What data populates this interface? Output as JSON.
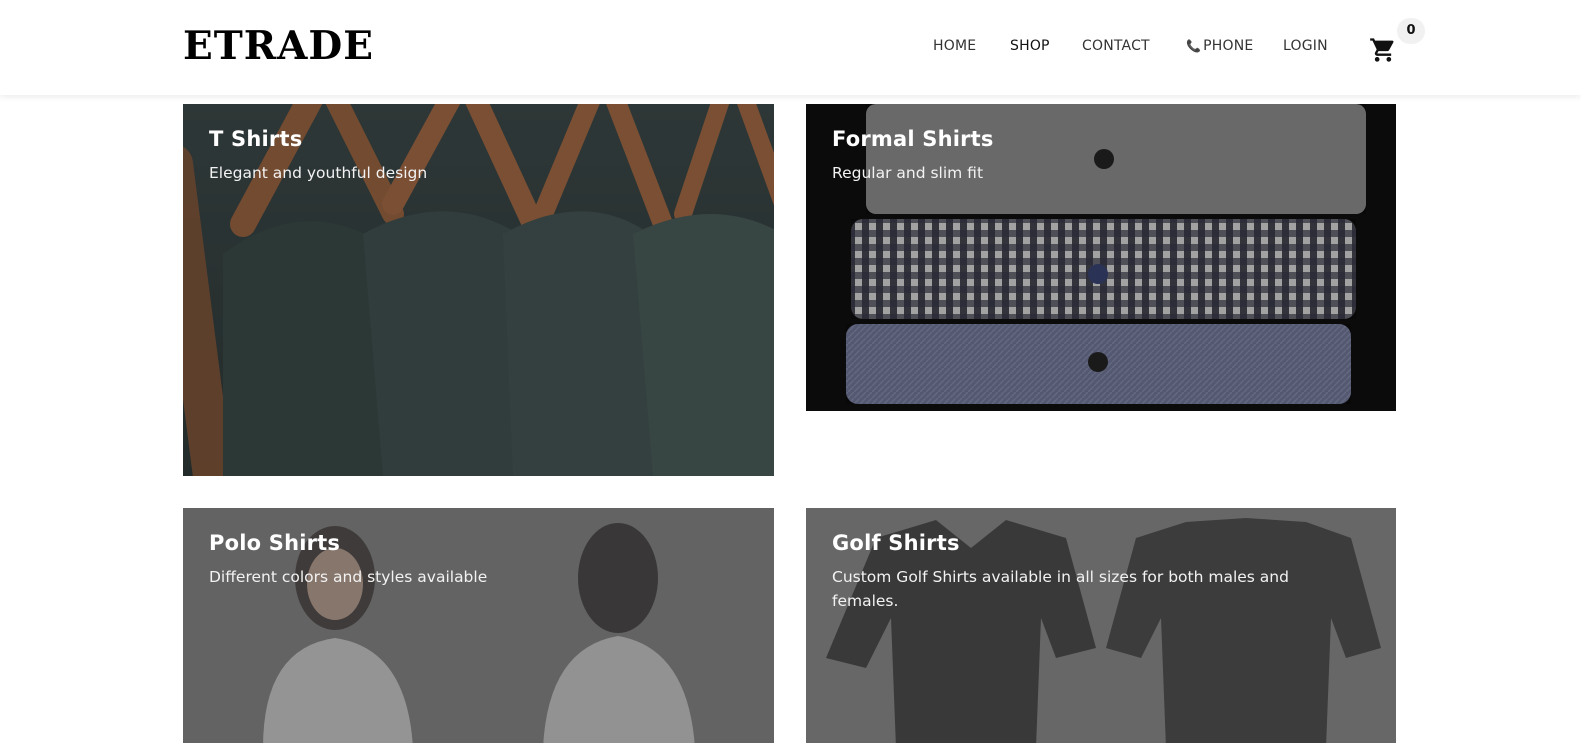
{
  "brand": {
    "logo_text": "ETRADE"
  },
  "nav": {
    "items": [
      {
        "label": "HOME"
      },
      {
        "label": "SHOP"
      },
      {
        "label": "CONTACT"
      },
      {
        "label": "PHONE",
        "icon": "phone-icon"
      },
      {
        "label": "LOGIN"
      }
    ],
    "cart": {
      "icon": "cart-icon",
      "count": "0"
    }
  },
  "tiles": [
    {
      "title": "T Shirts",
      "subtitle": "Elegant and youthful design"
    },
    {
      "title": "Formal Shirts",
      "subtitle": "Regular and slim fit"
    },
    {
      "title": "Polo Shirts",
      "subtitle": "Different colors and styles available"
    },
    {
      "title": "Golf Shirts",
      "subtitle": "Custom Golf Shirts available in all sizes for both males and females."
    }
  ],
  "colors": {
    "header_bg": "#ffffff",
    "text_dark": "#111111",
    "nav_text": "#333333",
    "tile_text": "#ffffff"
  }
}
